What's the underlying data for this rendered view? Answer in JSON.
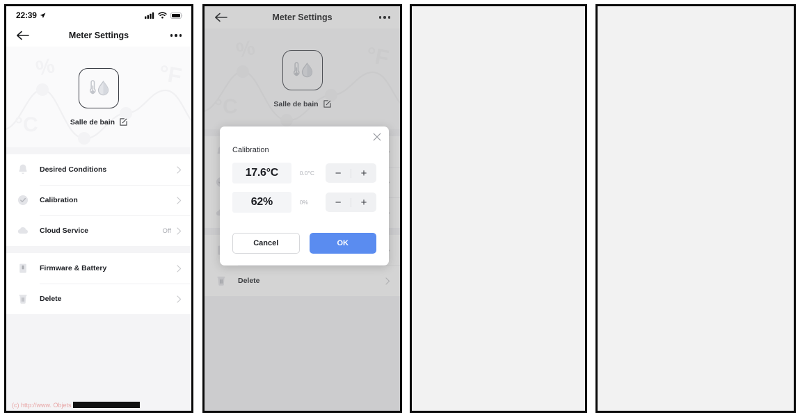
{
  "meta": {
    "panel_count": 4,
    "accent_color": "#5a8cf0",
    "bg_color": "#f2f2f2"
  },
  "watermark": {
    "prefix": "(c) http://www. Objets",
    "redacted": true
  },
  "status_bar": {
    "time": "22:39",
    "location_icon": "location-arrow-icon",
    "signal_icon": "cellular-signal-icon",
    "wifi_icon": "wifi-icon",
    "battery_icon": "battery-full-icon"
  },
  "nav": {
    "back_icon": "arrow-left-icon",
    "title": "Meter Settings",
    "more_icon": "more-options-icon"
  },
  "hero": {
    "device_icon": "thermometer-humidity-icon",
    "device_name": "Salle de bain",
    "edit_icon": "edit-pencil-icon",
    "decor": [
      "%",
      "°F",
      "°C"
    ]
  },
  "settings_groups": [
    {
      "items": [
        {
          "icon": "bell-icon",
          "label": "Desired Conditions",
          "value": "",
          "chevron": "chevron-right-icon"
        },
        {
          "icon": "check-circle-icon",
          "label": "Calibration",
          "value": "",
          "chevron": "chevron-right-icon"
        },
        {
          "icon": "cloud-icon",
          "label": "Cloud Service",
          "value": "Off",
          "chevron": "chevron-right-icon"
        }
      ]
    },
    {
      "items": [
        {
          "icon": "battery-chip-icon",
          "label": "Firmware & Battery",
          "value": "",
          "chevron": "chevron-right-icon"
        },
        {
          "icon": "trash-icon",
          "label": "Delete",
          "value": "",
          "chevron": "chevron-right-icon"
        }
      ]
    }
  ],
  "dialog": {
    "close_icon": "close-icon",
    "title": "Calibration",
    "rows": [
      {
        "value": "17.6°C",
        "offset": "0.0°C",
        "minus": "−",
        "plus": "+"
      },
      {
        "value": "62%",
        "offset": "0%",
        "minus": "−",
        "plus": "+"
      }
    ],
    "cancel_label": "Cancel",
    "ok_label": "OK"
  }
}
